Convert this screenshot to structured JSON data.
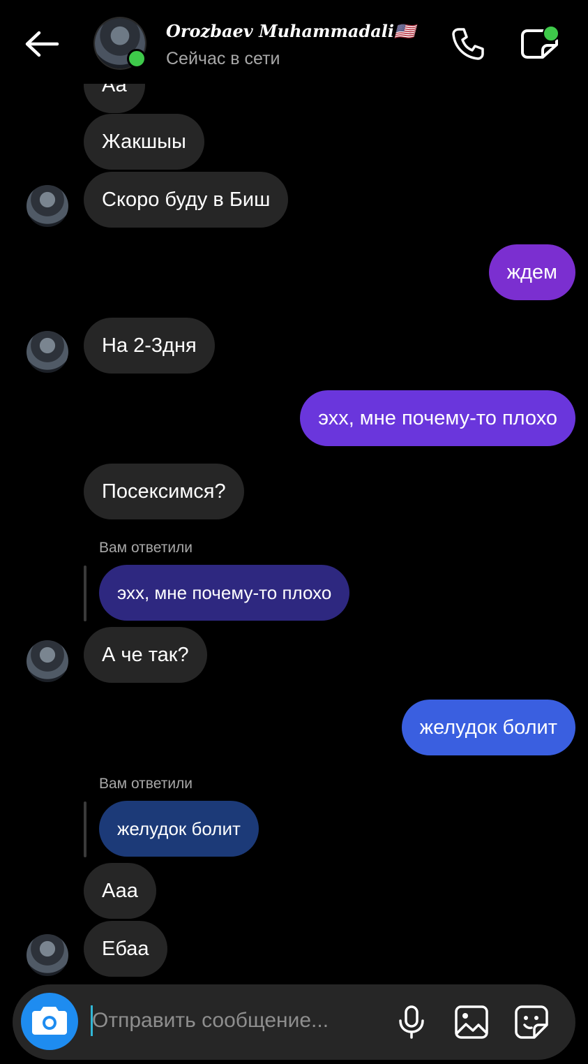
{
  "header": {
    "contact_name": "Orozbaev Muhammadali🇺🇸",
    "status": "Сейчас в сети",
    "icons": [
      "back-arrow-icon",
      "phone-icon",
      "video-call-icon"
    ]
  },
  "messages": [
    {
      "side": "in",
      "text": "Аа"
    },
    {
      "side": "in",
      "text": "Жакшыы"
    },
    {
      "side": "in",
      "text": "Скоро буду в Биш"
    },
    {
      "side": "out",
      "text": "ждем"
    },
    {
      "side": "in",
      "text": "На 2-3дня"
    },
    {
      "side": "out",
      "text": "эхх, мне почему-то плохо"
    },
    {
      "side": "in",
      "text": "Посексимся?"
    },
    {
      "side": "in",
      "text": "А че так?",
      "reply_label": "Вам ответили",
      "reply_text": "эхх, мне почему-то плохо"
    },
    {
      "side": "out",
      "text": "желудок болит"
    },
    {
      "side": "in",
      "text": "Ааа",
      "reply_label": "Вам ответили",
      "reply_text": "желудок болит"
    },
    {
      "side": "in",
      "text": "Ебаа"
    }
  ],
  "composer": {
    "placeholder": "Отправить сообщение...",
    "icons": [
      "camera-icon",
      "microphone-icon",
      "gallery-icon",
      "sticker-icon"
    ]
  },
  "colors": {
    "background": "#000000",
    "incoming_bubble": "#262626",
    "out_purple": "#7b2fd0",
    "out_violet": "#6a36dc",
    "out_blue": "#3a5fe0",
    "reply_1": "#2e2880",
    "reply_2": "#1c3a78",
    "online": "#3ec94a",
    "camera_button": "#1e8cf0"
  }
}
